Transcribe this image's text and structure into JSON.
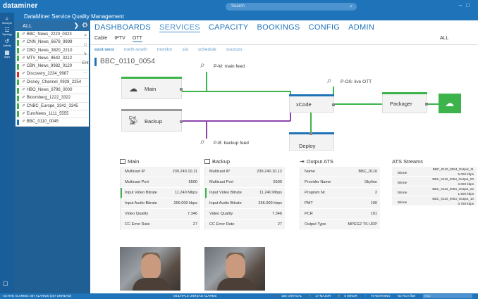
{
  "app": {
    "logo": "dataminer",
    "title": "DataMiner Service Quality Management"
  },
  "search": {
    "placeholder": "Search"
  },
  "leftbar": [
    {
      "icon": "surveyor-icon",
      "glyph": "⌕",
      "label": "Surveyor"
    },
    {
      "icon": "topology-icon",
      "glyph": "☳",
      "label": "Topology"
    },
    {
      "icon": "activity-icon",
      "glyph": "↺",
      "label": "Activity"
    },
    {
      "icon": "apps-icon",
      "glyph": "▦",
      "label": "Apps"
    }
  ],
  "list": {
    "header": "ALL",
    "items": [
      {
        "name": "BBC_News_2220_0323",
        "color": "#3cb44b"
      },
      {
        "name": "CNN_News_6678_9999",
        "color": "#3cb44b"
      },
      {
        "name": "CBO_News_3820_2210",
        "color": "#3cb44b"
      },
      {
        "name": "MTV_News_9642_3212",
        "color": "#3cb44b"
      },
      {
        "name": "CBN_News_9982_0120",
        "color": "#3cb44b"
      },
      {
        "name": "Discovery_2234_9987",
        "color": "#e52b2b"
      },
      {
        "name": "Disney_Channel_0928_2254",
        "color": "#3cb44b"
      },
      {
        "name": "HBO_News_8796_0000",
        "color": "#3cb44b"
      },
      {
        "name": "Bloomberg_1222_3322",
        "color": "#3cb44b"
      },
      {
        "name": "CNBC_Europe_3342_3345",
        "color": "#3cb44b"
      },
      {
        "name": "EuroNews_1111_5555",
        "color": "#3cb44b"
      },
      {
        "name": "BBC_0110_0045",
        "color": "#1e73b9"
      }
    ]
  },
  "tools": [
    "≡",
    ">",
    "□",
    "↳",
    "Ent",
    "…"
  ],
  "tabs": [
    "DASHBOARDS",
    "SERVICES",
    "CAPACITY",
    "BOOKINGS",
    "CONFIG",
    "ADMIN"
  ],
  "subtabs": [
    "Cable",
    "IPTV",
    "OTT"
  ],
  "alltab": "ALL",
  "views": [
    "east-west",
    "north-south",
    "monitor",
    "sla",
    "schedule",
    "sources"
  ],
  "selected_service": "BBC_0110_0054",
  "diagram": {
    "nodes": {
      "main": "Main",
      "backup": "Backup",
      "xcode": "xCode",
      "deploy": "Deploy",
      "packager": "Packager"
    },
    "probes": {
      "main": "P-M: main feed",
      "backup": "P-B: backup feed",
      "ott": "P-OS: live OTT"
    }
  },
  "main_table": {
    "title": "Main",
    "rows": [
      {
        "k": "Multicast IP",
        "v": "239.240.10.11"
      },
      {
        "k": "Multicast Port",
        "v": "5500"
      },
      {
        "k": "Input Video Bitrate",
        "v": "11.240 Mbps"
      },
      {
        "k": "Input Audio Bitrate",
        "v": "256.000 kbps"
      },
      {
        "k": "Video Quality",
        "v": "7.346"
      },
      {
        "k": "CC Error Rate",
        "v": "27"
      }
    ]
  },
  "backup_table": {
    "title": "Backup",
    "rows": [
      {
        "k": "Multicast IP",
        "v": "239.240.10.12"
      },
      {
        "k": "Multicast Port",
        "v": "5500"
      },
      {
        "k": "Input Video Bitrate",
        "v": "11.240 Mbps"
      },
      {
        "k": "Input Audio Bitrate",
        "v": "256.000 kbps"
      },
      {
        "k": "Video Quality",
        "v": "7.346"
      },
      {
        "k": "CC Error Rate",
        "v": "27"
      }
    ]
  },
  "output_table": {
    "title": "Output ATS",
    "rows": [
      {
        "k": "Name",
        "v": "BBC_0110"
      },
      {
        "k": "Provider Name",
        "v": "Skyline"
      },
      {
        "k": "Program Nr.",
        "v": "2"
      },
      {
        "k": "PMT",
        "v": "100"
      },
      {
        "k": "PCR",
        "v": "101"
      },
      {
        "k": "Output Type",
        "v": "MPEG2 TS UDP"
      }
    ]
  },
  "ats": {
    "title": "ATS Streams",
    "key": "Bitrate",
    "streams": [
      {
        "name": "BBC_0110_0054_Output_11",
        "bitrate": "5.000 kbps"
      },
      {
        "name": "BBC_0110_0054_Output_03",
        "bitrate": "3.000 kbps"
      },
      {
        "name": "BBC_0110_0054_Output_22",
        "bitrate": "1.500 kbps"
      },
      {
        "name": "BBC_0110_0054_Output_10",
        "bitrate": "0.768 kbps"
      }
    ]
  },
  "status": {
    "left": "ACTIVE ALARMS: 367 ALARMS (267 UNREAD)",
    "mid": "MULTIPLE UNREAD ALARMS",
    "counts": [
      "156 CRITICAL",
      "17 MAJOR",
      "5 MINOR",
      "79 WARNING"
    ],
    "filter": "Filter",
    "nolca": "No RCA filter"
  },
  "colors": {
    "accent": "#1e73b9",
    "ok": "#3cb44b",
    "alarm": "#e52b2b",
    "backup_link": "#8e44ad"
  }
}
